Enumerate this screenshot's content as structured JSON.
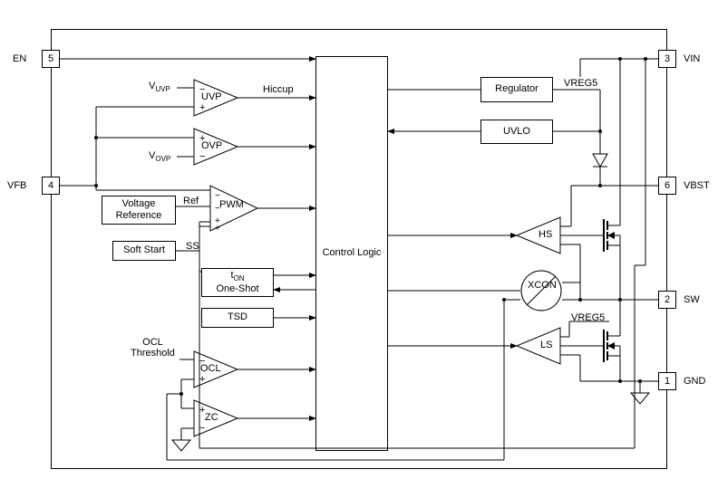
{
  "pins": {
    "p5": {
      "num": "5",
      "name": "EN"
    },
    "p4": {
      "num": "4",
      "name": "VFB"
    },
    "p3": {
      "num": "3",
      "name": "VIN"
    },
    "p6": {
      "num": "6",
      "name": "VBST"
    },
    "p2": {
      "num": "2",
      "name": "SW"
    },
    "p1": {
      "num": "1",
      "name": "GND"
    }
  },
  "blocks": {
    "control_logic": "Control Logic",
    "regulator": "Regulator",
    "uvlo": "UVLO",
    "voltage_reference": "Voltage\nReference",
    "soft_start": "Soft Start",
    "ton_oneshot": "t",
    "ton_oneshot_sub": "ON",
    "ton_oneshot_line2": "One-Shot",
    "tsd": "TSD",
    "xcon": "XCON"
  },
  "amps": {
    "uvp": "UVP",
    "ovp": "OVP",
    "pwm": "PWM",
    "ocl": "OCL",
    "zc": "ZC",
    "hs": "HS",
    "ls": "LS"
  },
  "labels": {
    "hiccup": "Hiccup",
    "ref": "Ref",
    "ss": "SS",
    "v_uvp": "V",
    "v_uvp_sub": "UVP",
    "v_ovp": "V",
    "v_ovp_sub": "OVP",
    "ocl_threshold": "OCL\nThreshold",
    "vreg5_top": "VREG5",
    "vreg5_bot": "VREG5"
  }
}
